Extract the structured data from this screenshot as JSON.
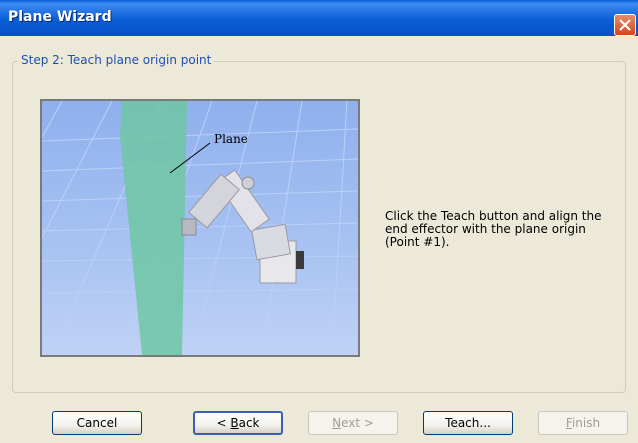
{
  "window": {
    "title": "Plane Wizard"
  },
  "group": {
    "label": "Step 2: Teach plane origin point"
  },
  "scene": {
    "plane_label": "Plane"
  },
  "instruction": "Click the Teach button and align the end effector with the plane origin (Point #1).",
  "buttons": {
    "cancel": "Cancel",
    "back_prefix": "< ",
    "back_mnemonic": "B",
    "back_rest": "ack",
    "next_mnemonic": "N",
    "next_rest": "ext >",
    "teach": "Teach...",
    "finish_mnemonic": "F",
    "finish_rest": "inish"
  }
}
